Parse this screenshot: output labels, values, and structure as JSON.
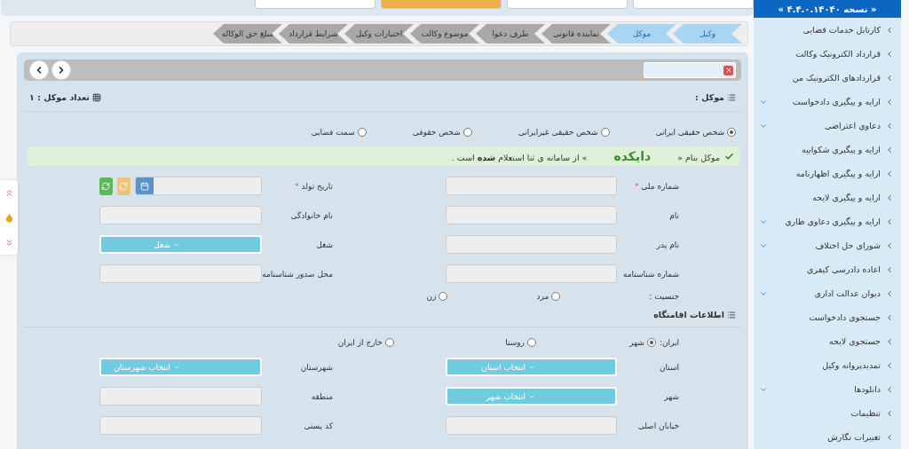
{
  "top_buttons": [
    {
      "kind": "default"
    },
    {
      "kind": "default"
    },
    {
      "kind": "accent"
    },
    {
      "kind": "default"
    }
  ],
  "tabs": [
    {
      "label": "وکیل",
      "active": true
    },
    {
      "label": "موکل",
      "active": true
    },
    {
      "label": "نماینده قانونی",
      "active": false
    },
    {
      "label": "طرف دعوا",
      "active": false
    },
    {
      "label": "موضوع وکالت",
      "active": false
    },
    {
      "label": "اختیارات وکیل",
      "active": false
    },
    {
      "label": "شرایط قرارداد",
      "active": false
    },
    {
      "label": "مبلغ حق الوکاله",
      "active": false
    }
  ],
  "client_header": {
    "title": "موکل :",
    "count_label": "تعداد موکل : ۱"
  },
  "person_types": [
    {
      "label": "شخص حقیقی ایرانی",
      "selected": true
    },
    {
      "label": "شخص حقیقی غیرایرانی",
      "selected": false
    },
    {
      "label": "شخص حقوقی",
      "selected": false
    },
    {
      "label": "سمت قضایی",
      "selected": false
    }
  ],
  "alert": {
    "prefix": "موکل بنام «",
    "name": "دایکده",
    "suffix": "» از سامانه ی ثنا استعلام **شده** است ."
  },
  "fields": [
    {
      "label": "شماره ملی",
      "required_mark": "*",
      "kind": "input"
    },
    {
      "label": "تاریخ تولد",
      "required_mark": "*",
      "kind": "date"
    },
    {
      "label": "نام",
      "kind": "input"
    },
    {
      "label": "نام خانوادگی",
      "kind": "input"
    },
    {
      "label": "نام پدر",
      "kind": "input"
    },
    {
      "label": "شغل",
      "kind": "select",
      "value": "شغل"
    },
    {
      "label": "شماره شناسنامه",
      "kind": "input"
    },
    {
      "label": "محل صدور شناسنامه",
      "kind": "input"
    }
  ],
  "gender": {
    "label": "جنسیت :",
    "options": [
      {
        "label": "مرد",
        "selected": false
      },
      {
        "label": "زن",
        "selected": false
      }
    ]
  },
  "residence": {
    "title": "اطلاعات اقامتگاه",
    "country_label": "ایران:",
    "options": [
      {
        "label": "شهر",
        "selected": true
      },
      {
        "label": "روستا",
        "selected": false
      },
      {
        "label": "خارج از ایران",
        "selected": false
      }
    ],
    "fields": [
      {
        "label": "استان",
        "kind": "select",
        "value": "انتخاب استان"
      },
      {
        "label": "شهرستان",
        "kind": "select",
        "value": "انتخاب شهرستان"
      },
      {
        "label": "شهر",
        "kind": "select",
        "value": "انتخاب شهر"
      },
      {
        "label": "منطقه",
        "kind": "input"
      },
      {
        "label": "خیابان اصلی",
        "kind": "input"
      },
      {
        "label": "کد پستی",
        "kind": "input"
      }
    ]
  },
  "sidebar": {
    "version": "« نسخه ۴.۴.۰.۱۴۰۴۰ »",
    "items": [
      {
        "label": "کارتابل خدمات قضایی",
        "has_submenu": false
      },
      {
        "label": "قرارداد الکترونیک وکالت",
        "has_submenu": false
      },
      {
        "label": "قراردادهای الکترونیک من",
        "has_submenu": false
      },
      {
        "label": "ارایه و پیگیری دادخواست",
        "has_submenu": true
      },
      {
        "label": "دعاوی اعتراضی",
        "has_submenu": true
      },
      {
        "label": "ارایه و پیگیری شکواییه",
        "has_submenu": false
      },
      {
        "label": "ارایه و پیگیری اظهارنامه",
        "has_submenu": false
      },
      {
        "label": "ارایه و پیگیری لایحه",
        "has_submenu": false
      },
      {
        "label": "ارایه و پیگیری دعاوی طاری",
        "has_submenu": true
      },
      {
        "label": "شورای حل اختلاف",
        "has_submenu": true
      },
      {
        "label": "اعاده دادرسی کیفری",
        "has_submenu": false
      },
      {
        "label": "دیوان عدالت اداری",
        "has_submenu": true
      },
      {
        "label": "جستجوی دادخواست",
        "has_submenu": false
      },
      {
        "label": "جستجوی لایحه",
        "has_submenu": false
      },
      {
        "label": "تمدیدپروانه وکیل",
        "has_submenu": false
      },
      {
        "label": "دانلودها",
        "has_submenu": true
      },
      {
        "label": "تنظیمات",
        "has_submenu": false
      },
      {
        "label": "تغییرات نگارش",
        "has_submenu": false
      }
    ]
  }
}
